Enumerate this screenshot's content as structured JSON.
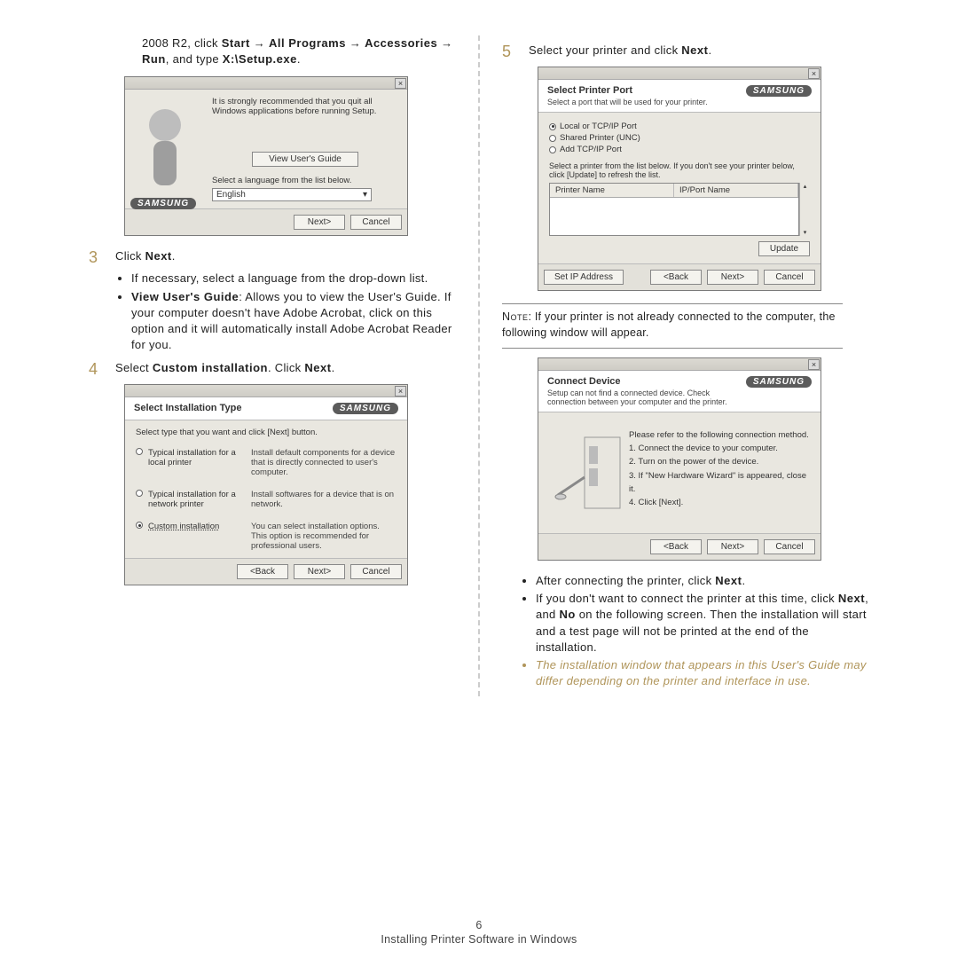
{
  "page_number": "6",
  "footer_title": "Installing Printer Software in Windows",
  "left": {
    "intro_pre": "2008 R2, click ",
    "intro_path": [
      "Start",
      "All Programs",
      "Accessories",
      "Run"
    ],
    "intro_post": ", and type ",
    "intro_cmd": "X:\\Setup.exe",
    "step3_num": "3",
    "step3_text_pre": "Click ",
    "step3_text_b": "Next",
    "step3_bullets": [
      {
        "plain": "If necessary, select a language from the drop-down list."
      },
      {
        "b": "View User's Guide",
        "rest": ": Allows you to view the User's Guide. If your computer doesn't have Adobe Acrobat, click on this option and it will automatically install Adobe Acrobat Reader for you."
      }
    ],
    "step4_num": "4",
    "step4_pre": "Select ",
    "step4_b": "Custom installation",
    "step4_mid": ". Click ",
    "step4_b2": "Next",
    "dlg1": {
      "recommend": "It is strongly recommended that you quit all Windows applications before running Setup.",
      "view_btn": "View User's Guide",
      "lang_label": "Select a language from the list below.",
      "lang_value": "English",
      "next": "Next>",
      "cancel": "Cancel",
      "brand": "SAMSUNG"
    },
    "dlg2": {
      "title": "Select Installation Type",
      "subtitle": "Select type that you want and click [Next] button.",
      "brand": "SAMSUNG",
      "opts": [
        {
          "label": "Typical installation for a local printer",
          "desc": "Install default components for a device that is directly connected to user's computer.",
          "on": false
        },
        {
          "label": "Typical installation for a network printer",
          "desc": "Install softwares for a device that is on network.",
          "on": false
        },
        {
          "label": "Custom installation",
          "desc": "You can select installation options. This option is recommended for professional users.",
          "on": true
        }
      ],
      "back": "<Back",
      "next": "Next>",
      "cancel": "Cancel"
    }
  },
  "right": {
    "step5_num": "5",
    "step5_pre": "Select your printer and click ",
    "step5_b": "Next",
    "note_label": "Note",
    "note_text": ": If your printer is not already connected to the computer, the following window will appear.",
    "after_bullets": [
      {
        "plain_pre": "After connecting the printer, click ",
        "b": "Next",
        "plain_post": "."
      },
      {
        "plain_pre": "If you don't want to connect the printer at this time, click ",
        "b": "Next",
        "mid": ", and ",
        "b2": "No",
        "rest": " on the following screen. Then the installation will start and a test page will not be printed at the end of the installation."
      }
    ],
    "italic_note": "The installation window that appears in this User's Guide may differ depending on the printer and interface in use.",
    "dlg3": {
      "title": "Select Printer Port",
      "subtitle": "Select a port that will be used for your printer.",
      "brand": "SAMSUNG",
      "radios": [
        {
          "label": "Local or TCP/IP Port",
          "on": true
        },
        {
          "label": "Shared Printer (UNC)",
          "on": false
        },
        {
          "label": "Add TCP/IP Port",
          "on": false
        }
      ],
      "instr": "Select a printer from the list below. If you don't see your printer below, click [Update] to refresh the list.",
      "col1": "Printer Name",
      "col2": "IP/Port Name",
      "update": "Update",
      "setip": "Set IP Address",
      "back": "<Back",
      "next": "Next>",
      "cancel": "Cancel"
    },
    "dlg4": {
      "title": "Connect Device",
      "subtitle": "Setup can not find a connected device. Check connection between your computer and the printer.",
      "brand": "SAMSUNG",
      "lines": [
        "Please refer to the following connection method.",
        "1. Connect the device to your computer.",
        "2. Turn on the power of the device.",
        "3. If \"New Hardware Wizard\" is appeared, close it.",
        "4. Click [Next]."
      ],
      "back": "<Back",
      "next": "Next>",
      "cancel": "Cancel"
    }
  }
}
